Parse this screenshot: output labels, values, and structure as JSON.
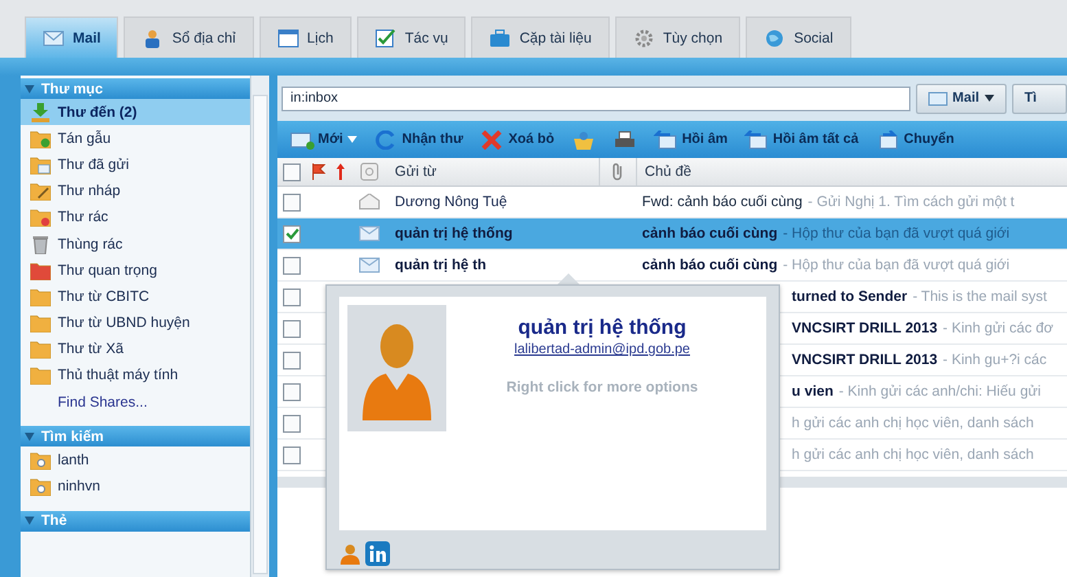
{
  "tabs": [
    {
      "label": "Mail",
      "selected": true
    },
    {
      "label": "Sổ địa chỉ",
      "selected": false
    },
    {
      "label": "Lịch",
      "selected": false
    },
    {
      "label": "Tác vụ",
      "selected": false
    },
    {
      "label": "Cặp tài liệu",
      "selected": false
    },
    {
      "label": "Tùy chọn",
      "selected": false
    },
    {
      "label": "Social",
      "selected": false
    }
  ],
  "sidebar": {
    "sections": [
      {
        "title": "Thư mục",
        "items": [
          {
            "label": "Thư đến (2)",
            "kind": "inbox",
            "selected": true
          },
          {
            "label": "Tán gẫu",
            "kind": "chat",
            "selected": false
          },
          {
            "label": "Thư đã gửi",
            "kind": "sent",
            "selected": false
          },
          {
            "label": "Thư nháp",
            "kind": "draft",
            "selected": false
          },
          {
            "label": "Thư rác",
            "kind": "junk",
            "selected": false
          },
          {
            "label": "Thùng rác",
            "kind": "trash",
            "selected": false
          },
          {
            "label": "Thư quan trọng",
            "kind": "folder-red",
            "selected": false
          },
          {
            "label": "Thư từ CBITC",
            "kind": "folder",
            "selected": false
          },
          {
            "label": "Thư từ UBND huyện",
            "kind": "folder",
            "selected": false
          },
          {
            "label": "Thư từ Xã",
            "kind": "folder",
            "selected": false
          },
          {
            "label": "Thủ thuật máy tính",
            "kind": "folder",
            "selected": false
          },
          {
            "label": "Find Shares...",
            "kind": "link",
            "selected": false
          }
        ]
      },
      {
        "title": "Tìm kiếm",
        "items": [
          {
            "label": "lanth",
            "kind": "search",
            "selected": false
          },
          {
            "label": "ninhvn",
            "kind": "search",
            "selected": false
          }
        ]
      },
      {
        "title": "Thẻ"
      }
    ]
  },
  "search": {
    "value": "in:inbox",
    "type_button": "Mail",
    "next_button": "Tì"
  },
  "toolbar": [
    {
      "label": "Mới",
      "kind": "new"
    },
    {
      "label": "Nhận thư",
      "kind": "get"
    },
    {
      "label": "Xoá bỏ",
      "kind": "delete"
    },
    {
      "kind": "move"
    },
    {
      "kind": "print"
    },
    {
      "label": "Hồi âm",
      "kind": "reply"
    },
    {
      "label": "Hồi âm tất cả",
      "kind": "reply-all"
    },
    {
      "label": "Chuyển",
      "kind": "forward"
    }
  ],
  "list": {
    "select_all": {
      "checked": false
    },
    "columns": {
      "from": "Gửi từ",
      "subject": "Chủ đề"
    },
    "rows": [
      {
        "from": "Dương Nông Tuệ",
        "subject": "Fwd: cảnh báo cuối cùng",
        "preview": "- Gửi Nghị 1. Tìm cách gửi một t",
        "unread": false,
        "checked": false,
        "selected": false
      },
      {
        "from": "quản trị hệ thống",
        "subject": "cảnh báo cuối cùng",
        "preview": "- Hộp thư của bạn đã vượt quá giới",
        "unread": true,
        "checked": true,
        "selected": true
      },
      {
        "from": "quản trị hệ th",
        "subject": "cảnh báo cuối cùng",
        "preview": "- Hộp thư của bạn đã vượt quá giới",
        "unread": true,
        "checked": false,
        "selected": false
      },
      {
        "subject": "turned to Sender",
        "preview": "- This is the mail syst",
        "checked": false,
        "selected": false
      },
      {
        "subject": "VNCSIRT DRILL 2013",
        "preview": "- Kinh gửi các đơ",
        "checked": false,
        "selected": false
      },
      {
        "subject": "VNCSIRT DRILL 2013",
        "preview": "- Kinh gu+?i các",
        "checked": false,
        "selected": false
      },
      {
        "subject": "u vien",
        "preview": "- Kinh gửi các anh/chi: Hiếu gửi",
        "checked": false,
        "selected": false
      },
      {
        "preview": "h gửi các anh chị học viên, danh sách",
        "checked": false,
        "selected": false
      },
      {
        "preview": "h gửi các anh chị học viên, danh sách",
        "checked": false,
        "selected": false
      }
    ]
  },
  "popup": {
    "name": "quản trị hệ thống",
    "email": "lalibertad-admin@ipd.gob.pe",
    "hint": "Right click for more options"
  }
}
